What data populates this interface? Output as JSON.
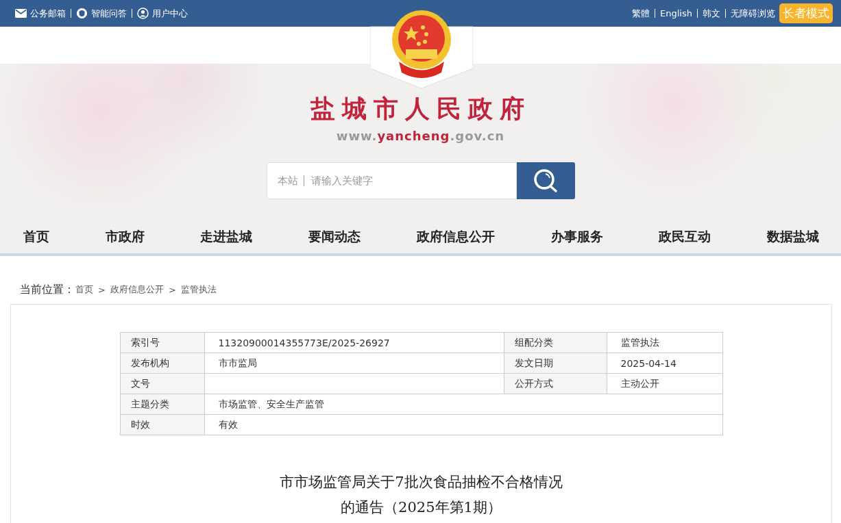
{
  "top_bar": {
    "left_links": [
      {
        "kind": "mail",
        "label": "公务邮箱"
      },
      {
        "kind": "chat",
        "label": "智能问答"
      },
      {
        "kind": "user",
        "label": "用户中心"
      }
    ],
    "right_links": [
      "繁體",
      "English",
      "韩文",
      "无障碍浏览"
    ],
    "elder_button": "长者模式"
  },
  "header": {
    "site_name": "盐城市人民政府",
    "site_url": "www.**yancheng**.gov.cn"
  },
  "search": {
    "scope": "本站",
    "placeholder": "请输入关键字"
  },
  "nav": [
    "首页",
    "市政府",
    "走进盐城",
    "要闻动态",
    "政府信息公开",
    "办事服务",
    "政民互动",
    "数据盐城"
  ],
  "breadcrumb": {
    "label": "当前位置：",
    "items": [
      "首页",
      "政府信息公开",
      "监管执法"
    ],
    "separator": ">"
  },
  "meta_table": {
    "rows": [
      {
        "cells": [
          "索引号",
          "11320900014355773E/2025-26927",
          "组配分类",
          "监管执法"
        ]
      },
      {
        "cells": [
          "发布机构",
          "市市监局",
          "发文日期",
          "2025-04-14"
        ]
      },
      {
        "cells": [
          "文号",
          "",
          "公开方式",
          "主动公开"
        ]
      }
    ]
  },
  "meta_table_wide": {
    "rows": [
      {
        "cells": [
          "主题分类",
          "市场监管、安全生产监管"
        ]
      },
      {
        "cells": [
          "时效",
          "有效"
        ]
      }
    ]
  },
  "article": {
    "title_lines": [
      "市市场监管局关于7批次食品抽检不合格情况",
      "的通告（2025年第1期）"
    ]
  }
}
